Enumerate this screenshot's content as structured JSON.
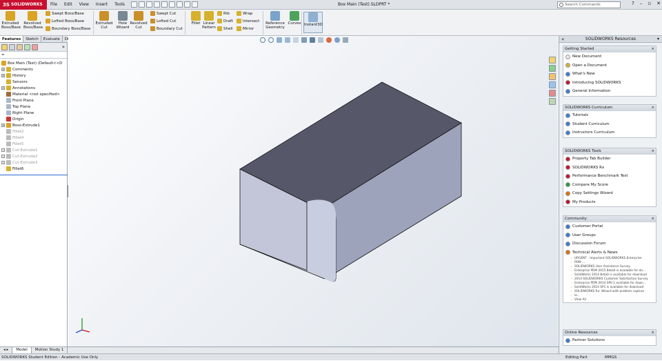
{
  "app": {
    "logo_text": "SOLIDWORKS",
    "logo_mark": "3S",
    "menu": [
      "File",
      "Edit",
      "View",
      "Insert",
      "Tools"
    ],
    "document_title": "Box Main (Test).SLDPRT *",
    "search_placeholder": "Search Commands",
    "window_buttons": [
      "?",
      "–",
      "▫",
      "✕"
    ]
  },
  "ribbon": {
    "big": [
      {
        "label1": "Extruded",
        "label2": "Boss/Base",
        "color": "#d9a326"
      },
      {
        "label1": "Revolved",
        "label2": "Boss/Base",
        "color": "#d9a326"
      },
      {
        "label1": "Extruded",
        "label2": "Cut",
        "color": "#c9902a"
      },
      {
        "label1": "Hole",
        "label2": "Wizard",
        "color": "#7a8794"
      },
      {
        "label1": "Revolved",
        "label2": "Cut",
        "color": "#c9902a"
      },
      {
        "label1": "Fillet",
        "label2": "",
        "color": "#d6b12e"
      },
      {
        "label1": "Linear",
        "label2": "Pattern",
        "color": "#d6b12e"
      },
      {
        "label1": "Reference",
        "label2": "Geometry",
        "color": "#7aa3c9"
      },
      {
        "label1": "Curves",
        "label2": "",
        "color": "#4ea35a"
      },
      {
        "label1": "Instant3D",
        "label2": "",
        "color": "#8fb0d0"
      }
    ],
    "small": [
      {
        "label": "Swept Boss/Base",
        "color": "#d9a326"
      },
      {
        "label": "Lofted Boss/Base",
        "color": "#d9a326"
      },
      {
        "label": "Boundary Boss/Base",
        "color": "#d9a326"
      },
      {
        "label": "Swept Cut",
        "color": "#c9902a"
      },
      {
        "label": "Lofted Cut",
        "color": "#c9902a"
      },
      {
        "label": "Boundary Cut",
        "color": "#c9902a"
      },
      {
        "label": "Rib",
        "color": "#d6b12e"
      },
      {
        "label": "Draft",
        "color": "#d6b12e"
      },
      {
        "label": "Shell",
        "color": "#d6b12e"
      },
      {
        "label": "Wrap",
        "color": "#d6b12e"
      },
      {
        "label": "Intersect",
        "color": "#d6b12e"
      },
      {
        "label": "Mirror",
        "color": "#d6b12e"
      }
    ]
  },
  "left_tabs": [
    "Features",
    "Sketch",
    "Evaluate",
    "DimXpert"
  ],
  "feature_tree": {
    "filter_icon": "funnel-icon",
    "root": "Box Main (Test)  (Default<<D",
    "nodes": [
      {
        "label": "Comments",
        "expand": true,
        "icon_color": "#d6b12e",
        "suppressed": false
      },
      {
        "label": "History",
        "expand": true,
        "icon_color": "#d6b12e",
        "suppressed": false
      },
      {
        "label": "Sensors",
        "expand": false,
        "icon_color": "#d6b12e",
        "suppressed": false
      },
      {
        "label": "Annotations",
        "expand": true,
        "icon_color": "#d6b12e",
        "suppressed": false
      },
      {
        "label": "Material <not specified>",
        "expand": false,
        "icon_color": "#a06a3a",
        "suppressed": false
      },
      {
        "label": "Front Plane",
        "expand": false,
        "icon_color": "#a9b8c8",
        "suppressed": false
      },
      {
        "label": "Top Plane",
        "expand": false,
        "icon_color": "#a9b8c8",
        "suppressed": false
      },
      {
        "label": "Right Plane",
        "expand": false,
        "icon_color": "#a9b8c8",
        "suppressed": false
      },
      {
        "label": "Origin",
        "expand": false,
        "icon_color": "#c33",
        "suppressed": false
      },
      {
        "label": "Boss-Extrude1",
        "expand": true,
        "icon_color": "#d9a326",
        "suppressed": false
      },
      {
        "label": "Fillet2",
        "expand": false,
        "icon_color": "#bbb",
        "suppressed": true
      },
      {
        "label": "Fillet4",
        "expand": false,
        "icon_color": "#bbb",
        "suppressed": true
      },
      {
        "label": "Fillet5",
        "expand": false,
        "icon_color": "#bbb",
        "suppressed": true
      },
      {
        "label": "Cut-Extrude1",
        "expand": true,
        "icon_color": "#bbb",
        "suppressed": true
      },
      {
        "label": "Cut-Extrude2",
        "expand": true,
        "icon_color": "#bbb",
        "suppressed": true
      },
      {
        "label": "Cut-Extrude3",
        "expand": true,
        "icon_color": "#bbb",
        "suppressed": true
      },
      {
        "label": "Fillet6",
        "expand": false,
        "icon_color": "#d6b12e",
        "suppressed": false
      }
    ]
  },
  "bottom_tabs": [
    "Model",
    "Motion Study 1"
  ],
  "status": {
    "left": "SOLIDWORKS Student Edition - Academic Use Only",
    "mode": "Editing Part",
    "units": "MMGS"
  },
  "resources": {
    "title": "SOLIDWORKS Resources",
    "sections": [
      {
        "title": "Getting Started",
        "items": [
          {
            "label": "New Document",
            "color": "#e9e9e9"
          },
          {
            "label": "Open a Document",
            "color": "#d6b12e"
          },
          {
            "label": "What's New",
            "color": "#3a7bd5"
          },
          {
            "label": "Introducing SOLIDWORKS",
            "color": "#c8102e"
          },
          {
            "label": "General Information",
            "color": "#3a7bd5"
          }
        ],
        "news": []
      },
      {
        "title": "SOLIDWORKS Curriculum",
        "items": [
          {
            "label": "Tutorials",
            "color": "#3a7bd5"
          },
          {
            "label": "Student Curriculum",
            "color": "#3a7bd5"
          },
          {
            "label": "Instructors Curriculum",
            "color": "#3a7bd5"
          }
        ],
        "news": []
      },
      {
        "title": "SOLIDWORKS Tools",
        "items": [
          {
            "label": "Property Tab Builder",
            "color": "#c8102e"
          },
          {
            "label": "SOLIDWORKS Rx",
            "color": "#c8102e"
          },
          {
            "label": "Performance Benchmark Test",
            "color": "#c8102e"
          },
          {
            "label": "Compare My Score",
            "color": "#2e9a3a"
          },
          {
            "label": "Copy Settings Wizard",
            "color": "#e07000"
          },
          {
            "label": "My Products",
            "color": "#c8102e"
          }
        ],
        "news": []
      },
      {
        "title": "Community",
        "items": [
          {
            "label": "Customer Portal",
            "color": "#3a7bd5"
          },
          {
            "label": "User Groups",
            "color": "#3a7bd5"
          },
          {
            "label": "Discussion Forum",
            "color": "#3a7bd5"
          },
          {
            "label": "Technical Alerts & News",
            "color": "#e07000"
          }
        ],
        "news": [
          "URGENT - Important SOLIDWORKS Enterprise",
          "PDM ...",
          "SOLIDWORKS User Assistance Survey",
          "Enterprise PDM 2015 Beta0 is available for do...",
          "SolidWorks 2014 Beta0 is available for download",
          "2014 SOLIDWORKS Customer Satisfaction Survey",
          "Enterprise PDM 2014 SP0.1 available for down...",
          "SolidWorks 2014 SP1 is available for download",
          "SOLIDWORKS Rx: Wizard with problem capture",
          "le...",
          "View All"
        ]
      },
      {
        "title": "Online Resources",
        "items": [
          {
            "label": "Partner Solutions",
            "color": "#3a7bd5"
          }
        ],
        "news": []
      }
    ]
  }
}
